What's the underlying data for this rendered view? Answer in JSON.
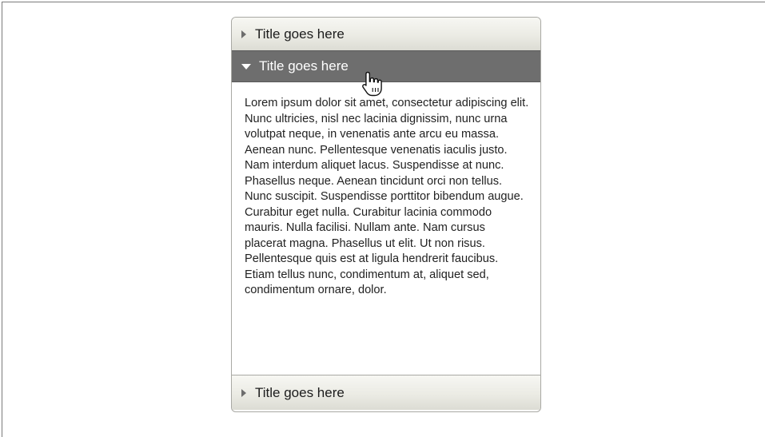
{
  "accordion": {
    "sections": [
      {
        "title": "Title goes here",
        "expanded": false,
        "icon": "triangle-right-icon"
      },
      {
        "title": "Title goes here",
        "expanded": true,
        "icon": "triangle-down-icon",
        "content": "Lorem ipsum dolor sit amet, consectetur adipiscing elit. Nunc ultricies, nisl nec lacinia dignissim, nunc urna volutpat neque, in venenatis ante arcu eu massa. Aenean nunc. Pellentesque venenatis iaculis justo. Nam interdum aliquet lacus. Suspendisse at nunc. Phasellus neque. Aenean tincidunt orci non tellus. Nunc suscipit. Suspendisse porttitor bibendum augue. Curabitur eget nulla. Curabitur lacinia commodo mauris. Nulla facilisi. Nullam ante. Nam cursus placerat magna. Phasellus ut elit. Ut non risus. Pellentesque quis est at ligula hendrerit faucibus. Etiam tellus nunc, condimentum at, aliquet sed, condimentum ornare, dolor."
      },
      {
        "title": "Title goes here",
        "expanded": false,
        "icon": "triangle-right-icon"
      }
    ]
  },
  "colors": {
    "header_closed_top": "#f7f7f3",
    "header_closed_bottom": "#dcdcd4",
    "header_open": "#6e6e6e",
    "border": "#a9a9a4",
    "text": "#222222"
  },
  "cursor": {
    "icon": "hand-pointer-icon"
  }
}
